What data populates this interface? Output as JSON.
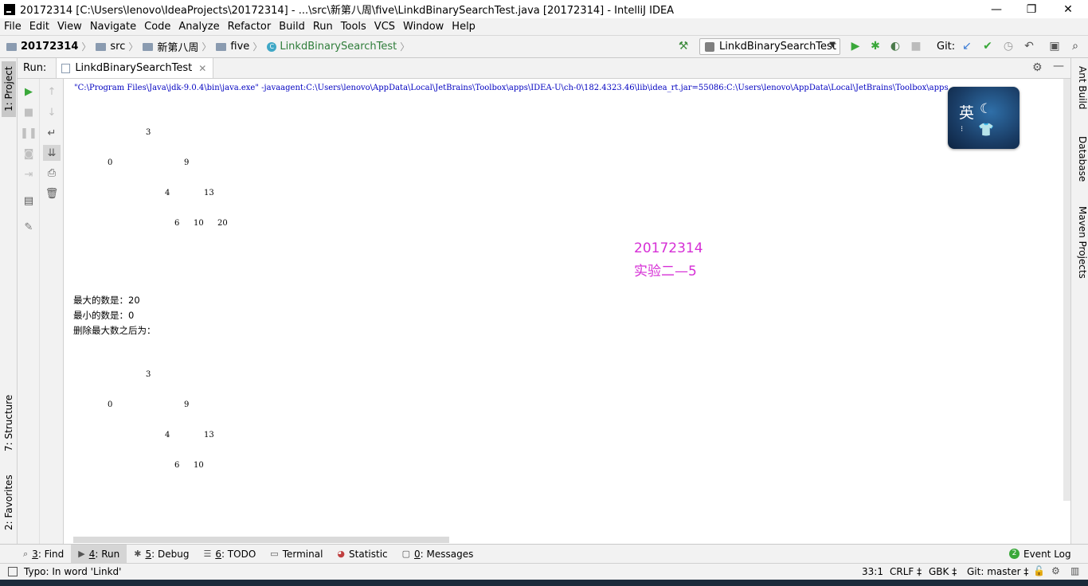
{
  "window": {
    "title": "20172314 [C:\\Users\\lenovo\\IdeaProjects\\20172314] - ...\\src\\新第八周\\five\\LinkdBinarySearchTest.java [20172314] - IntelliJ IDEA",
    "minimize": "—",
    "maximize": "❐",
    "close": "✕"
  },
  "menu": [
    "File",
    "Edit",
    "View",
    "Navigate",
    "Code",
    "Analyze",
    "Refactor",
    "Build",
    "Run",
    "Tools",
    "VCS",
    "Window",
    "Help"
  ],
  "breadcrumb": {
    "project": "20172314",
    "src": "src",
    "pkg1": "新第八周",
    "pkg2": "five",
    "cls": "LinkdBinarySearchTest"
  },
  "toolbar": {
    "run_config": "LinkdBinarySearchTest",
    "git_label": "Git:"
  },
  "left_tabs": {
    "project": "1: Project",
    "structure": "7: Structure",
    "favorites": "2: Favorites"
  },
  "right_tabs": {
    "ant": "Ant Build",
    "database": "Database",
    "maven": "Maven Projects"
  },
  "run_panel": {
    "label": "Run:",
    "tab": "LinkdBinarySearchTest"
  },
  "console": {
    "command": "\"C:\\Program Files\\Java\\jdk-9.0.4\\bin\\java.exe\" -javaagent:C:\\Users\\lenovo\\AppData\\Local\\JetBrains\\Toolbox\\apps\\IDEA-U\\ch-0\\182.4323.46\\lib\\idea_rt.jar=55086:C:\\Users\\lenovo\\AppData\\Local\\JetBrains\\Toolbox\\apps",
    "tree1": {
      "n3": "3",
      "n0": "0",
      "n9": "9",
      "n4": "4",
      "n13": "13",
      "n6": "6",
      "n10": "10",
      "n20": "20"
    },
    "max_line": "最大的数是：20",
    "min_line": "最小的数是：0",
    "after_delete": "删除最大数之后为：",
    "tree2": {
      "n3": "3",
      "n0": "0",
      "n9": "9",
      "n4": "4",
      "n13": "13",
      "n6": "6",
      "n10": "10"
    }
  },
  "watermark": {
    "id": "20172314",
    "exp": "实验二—5"
  },
  "ime": {
    "label": "英"
  },
  "bottom_tabs": [
    {
      "key": "3",
      "rest": ": Find"
    },
    {
      "key": "4",
      "rest": ": Run"
    },
    {
      "key": "5",
      "rest": ": Debug"
    },
    {
      "key": "6",
      "rest": ": TODO"
    },
    {
      "key": "",
      "rest": "Terminal"
    },
    {
      "key": "",
      "rest": "Statistic"
    },
    {
      "key": "0",
      "rest": ": Messages"
    }
  ],
  "event_log": {
    "badge": "2",
    "label": "Event Log"
  },
  "status": {
    "message": "Typo: In word 'Linkd'",
    "position": "33:1",
    "line_sep": "CRLF ‡",
    "encoding": "GBK ‡",
    "git": "Git: master ‡"
  }
}
